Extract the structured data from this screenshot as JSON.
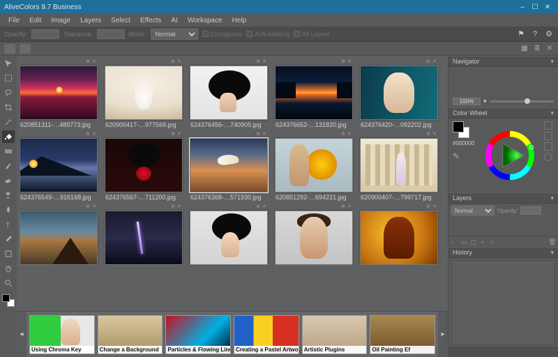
{
  "titlebar": {
    "title": "AliveColors 9.7 Business"
  },
  "menu": {
    "file": "File",
    "edit": "Edit",
    "image": "Image",
    "layers": "Layers",
    "select": "Select",
    "effects": "Effects",
    "ai": "AI",
    "workspace": "Workspace",
    "help": "Help"
  },
  "toolbar": {
    "opacity_lbl": "Opacity:",
    "tolerance_lbl": "Tolerance:",
    "mode_lbl": "Mode:",
    "mode_val": "Normal",
    "contiguous": "Contiguous",
    "anti": "Anti-Aliasing",
    "all": "All Layers"
  },
  "panels": {
    "navigator": "Navigator",
    "zoom": "100%",
    "colorwheel": "Color Wheel",
    "hex": "#000000",
    "layers": "Layers",
    "blend": "Normal",
    "op_lbl": "Opacity:",
    "history": "History"
  },
  "thumbs": {
    "r1": [
      {
        "f": "620851311-…489773.jpg"
      },
      {
        "f": "620900417-…977569.jpg"
      },
      {
        "f": "624376456-…740905.jpg"
      },
      {
        "f": "624376652-…131820.jpg"
      },
      {
        "f": "624376420-…092202.jpg"
      }
    ],
    "r2": [
      {
        "f": "624376549-…916168.jpg"
      },
      {
        "f": "624376567-…711200.jpg"
      },
      {
        "f": "624376368-…571930.jpg"
      },
      {
        "f": "620851292-…694221.jpg"
      },
      {
        "f": "620900407-…799717.jpg"
      }
    ]
  },
  "tutorials": {
    "t1": "Using Chroma Key",
    "t2": "Change a Background",
    "t3": "Particles & Flowing Lines",
    "t4": "Creating a Pastel Artwork",
    "t5": "Artistic Plugins",
    "t6": "Oil Painting Ef"
  }
}
